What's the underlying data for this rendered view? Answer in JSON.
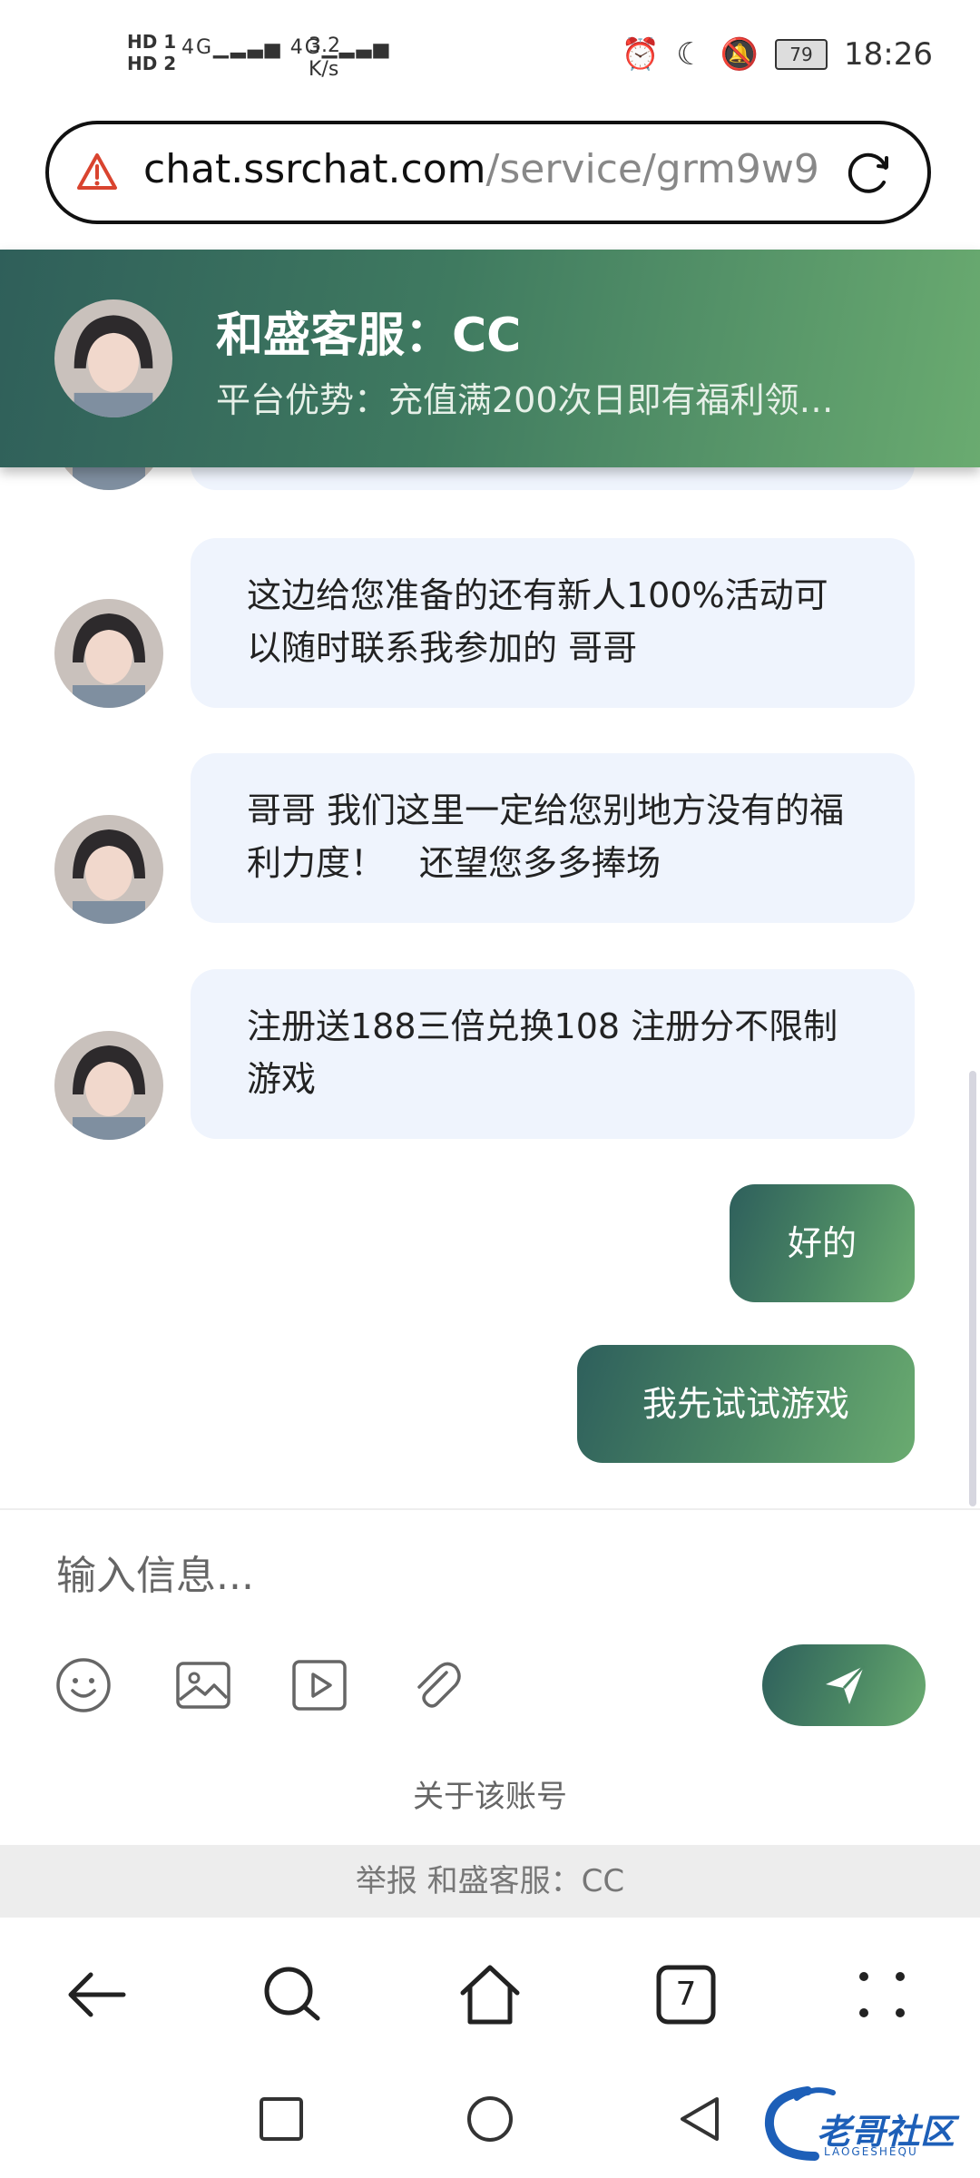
{
  "status_bar": {
    "hd1": "HD 1",
    "hd2": "HD 2",
    "signal1": "4G",
    "signal2": "4G",
    "speed": "3.2",
    "speed_unit": "K/s",
    "battery": "79",
    "time": "18:26"
  },
  "browser": {
    "url_host": "chat.ssrchat.com",
    "url_path": "/service/grm9w9",
    "tab_count": "7"
  },
  "chat": {
    "title": "和盛客服：CC",
    "subtitle": "平台优势：充值满200次日即有福利领…",
    "messages": [
      {
        "from": "agent",
        "text": "这边给您准备的还有新人100%活动可以随时联系我参加的 哥哥"
      },
      {
        "from": "agent",
        "text": "哥哥 我们这里一定给您别地方没有的福利力度！　还望您多多捧场"
      },
      {
        "from": "agent",
        "text": "注册送188三倍兑换108  注册分不限制游戏"
      },
      {
        "from": "me",
        "text": "好的"
      },
      {
        "from": "me",
        "text": "我先试试游戏"
      }
    ]
  },
  "composer": {
    "placeholder": "输入信息..."
  },
  "footer": {
    "about": "关于该账号",
    "report": "举报 和盛客服：CC"
  },
  "watermark": {
    "title": "老哥社区",
    "sub": "LAOGESHEQU"
  },
  "colors": {
    "accent_dark": "#2e5f5c",
    "accent_light": "#6aab70",
    "bubble_bg": "#eff4fd"
  },
  "icons": [
    "warning-icon",
    "reload-icon",
    "emoji-icon",
    "image-icon",
    "video-icon",
    "attachment-icon",
    "send-icon",
    "back-icon",
    "search-icon",
    "home-icon",
    "tabs-icon",
    "menu-icon"
  ]
}
